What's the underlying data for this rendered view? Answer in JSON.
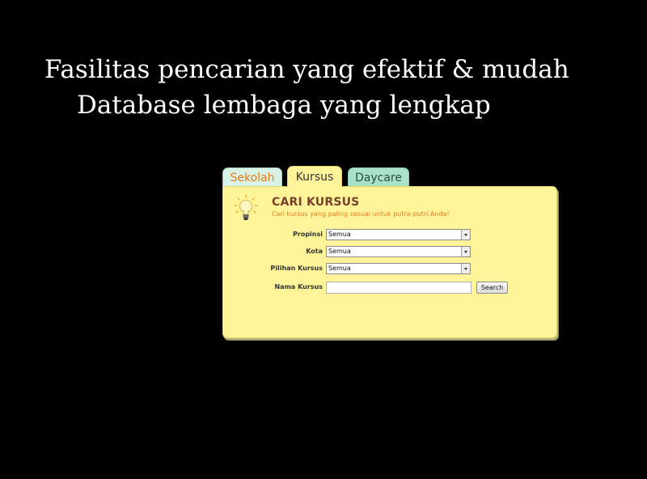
{
  "slide": {
    "headline_line1": "Fasilitas pencarian yang efektif & mudah",
    "headline_line2": "Database lembaga yang lengkap"
  },
  "tabs": [
    {
      "label": "Sekolah",
      "active": false
    },
    {
      "label": "Kursus",
      "active": true
    },
    {
      "label": "Daycare",
      "active": false
    }
  ],
  "panel": {
    "icon": "lightbulb-icon",
    "title": "CARI KURSUS",
    "subtitle": "Cari kursus yang paling sesuai untuk putra-putri Anda!"
  },
  "form": {
    "propinsi": {
      "label": "Propinsi",
      "value": "Semua"
    },
    "kota": {
      "label": "Kota",
      "value": "Semua"
    },
    "pilihan_kursus": {
      "label": "Pilihan Kursus",
      "value": "Semua"
    },
    "nama_kursus": {
      "label": "Nama Kursus",
      "value": ""
    },
    "search_label": "Search"
  },
  "colors": {
    "background": "#000000",
    "panel": "#fff49a",
    "tab_sekolah": "#d9f2e6",
    "tab_daycare": "#a8e3c8",
    "title": "#7a3f2a",
    "accent": "#e87a1c"
  }
}
